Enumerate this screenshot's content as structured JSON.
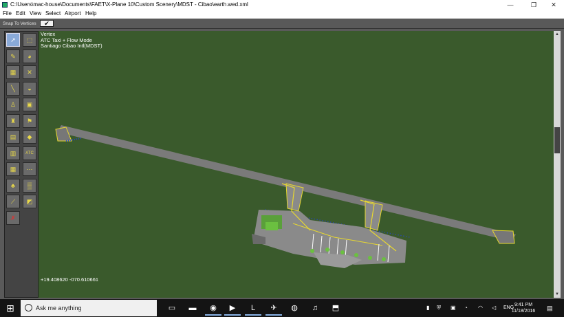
{
  "window": {
    "title": "C:\\Users\\mac-house\\Documents\\FAET\\X-Plane 10\\Custom Scenery\\MDST - Cibao\\earth.wed.xml",
    "minimize": "—",
    "maximize": "❐",
    "close": "✕"
  },
  "menu": [
    "File",
    "Edit",
    "View",
    "Select",
    "Airport",
    "Help"
  ],
  "snap": {
    "label": "Snap To Vertices",
    "checked": "✔"
  },
  "tools": [
    {
      "name": "vertex-tool-icon",
      "glyph": "➚",
      "active": true
    },
    {
      "name": "marquee-tool-icon",
      "glyph": "⬚",
      "active": false
    },
    {
      "name": "bezier-icon",
      "glyph": "✎",
      "active": false
    },
    {
      "name": "map-globe-icon",
      "glyph": "◕",
      "active": false
    },
    {
      "name": "taxiway-icon",
      "glyph": "▦",
      "active": false
    },
    {
      "name": "runway-cross-icon",
      "glyph": "✕",
      "active": false
    },
    {
      "name": "line-marking-icon",
      "glyph": "╲",
      "active": false
    },
    {
      "name": "ramp-icon",
      "glyph": "◒",
      "active": false
    },
    {
      "name": "light-fixture-icon",
      "glyph": "♙",
      "active": false
    },
    {
      "name": "sign-icon",
      "glyph": "▣",
      "active": false
    },
    {
      "name": "tower-icon",
      "glyph": "♜",
      "active": false
    },
    {
      "name": "windsock-icon",
      "glyph": "⚑",
      "active": false
    },
    {
      "name": "helipad-icon",
      "glyph": "▤",
      "active": false
    },
    {
      "name": "beacon-icon",
      "glyph": "◆",
      "active": false
    },
    {
      "name": "facade-icon",
      "glyph": "▥",
      "active": false
    },
    {
      "name": "atc-route-icon",
      "glyph": "ATC",
      "active": false
    },
    {
      "name": "object-icon",
      "glyph": "▦",
      "active": false
    },
    {
      "name": "string-icon",
      "glyph": "⋯",
      "active": false
    },
    {
      "name": "forest-icon",
      "glyph": "♣",
      "active": false
    },
    {
      "name": "draped-poly-icon",
      "glyph": "▒",
      "active": false
    },
    {
      "name": "line-icon",
      "glyph": "⟋",
      "active": false
    },
    {
      "name": "polygon-icon",
      "glyph": "◩",
      "active": false
    },
    {
      "name": "exclusion-icon",
      "glyph": "✗",
      "active": false
    }
  ],
  "overlay": {
    "tool": "Vertex",
    "mode": "ATC Taxi + Flow Mode",
    "airport": "Santiago Cibao Intl(MDST)"
  },
  "coordinates": "+19.408620 -070.610661",
  "taskbar": {
    "search_placeholder": "Ask me anything",
    "apps": [
      {
        "name": "task-view-icon",
        "glyph": "▭"
      },
      {
        "name": "file-explorer-icon",
        "glyph": "▬"
      },
      {
        "name": "chrome-icon",
        "glyph": "◉"
      },
      {
        "name": "media-player-icon",
        "glyph": "▶"
      },
      {
        "name": "app-l-icon",
        "glyph": "L"
      },
      {
        "name": "xplane-icon",
        "glyph": "✈"
      },
      {
        "name": "globe-icon",
        "glyph": "◍"
      },
      {
        "name": "itunes-icon",
        "glyph": "♫"
      },
      {
        "name": "installer-icon",
        "glyph": "⬒"
      }
    ],
    "tray_language": "ENG",
    "time": "9:41 PM",
    "date": "11/18/2016"
  },
  "colors": {
    "map_background": "#3a5a2c",
    "runway": "#7a7a7a",
    "taxi_route": "#e8d830",
    "edge_lights": "#2244dd"
  }
}
